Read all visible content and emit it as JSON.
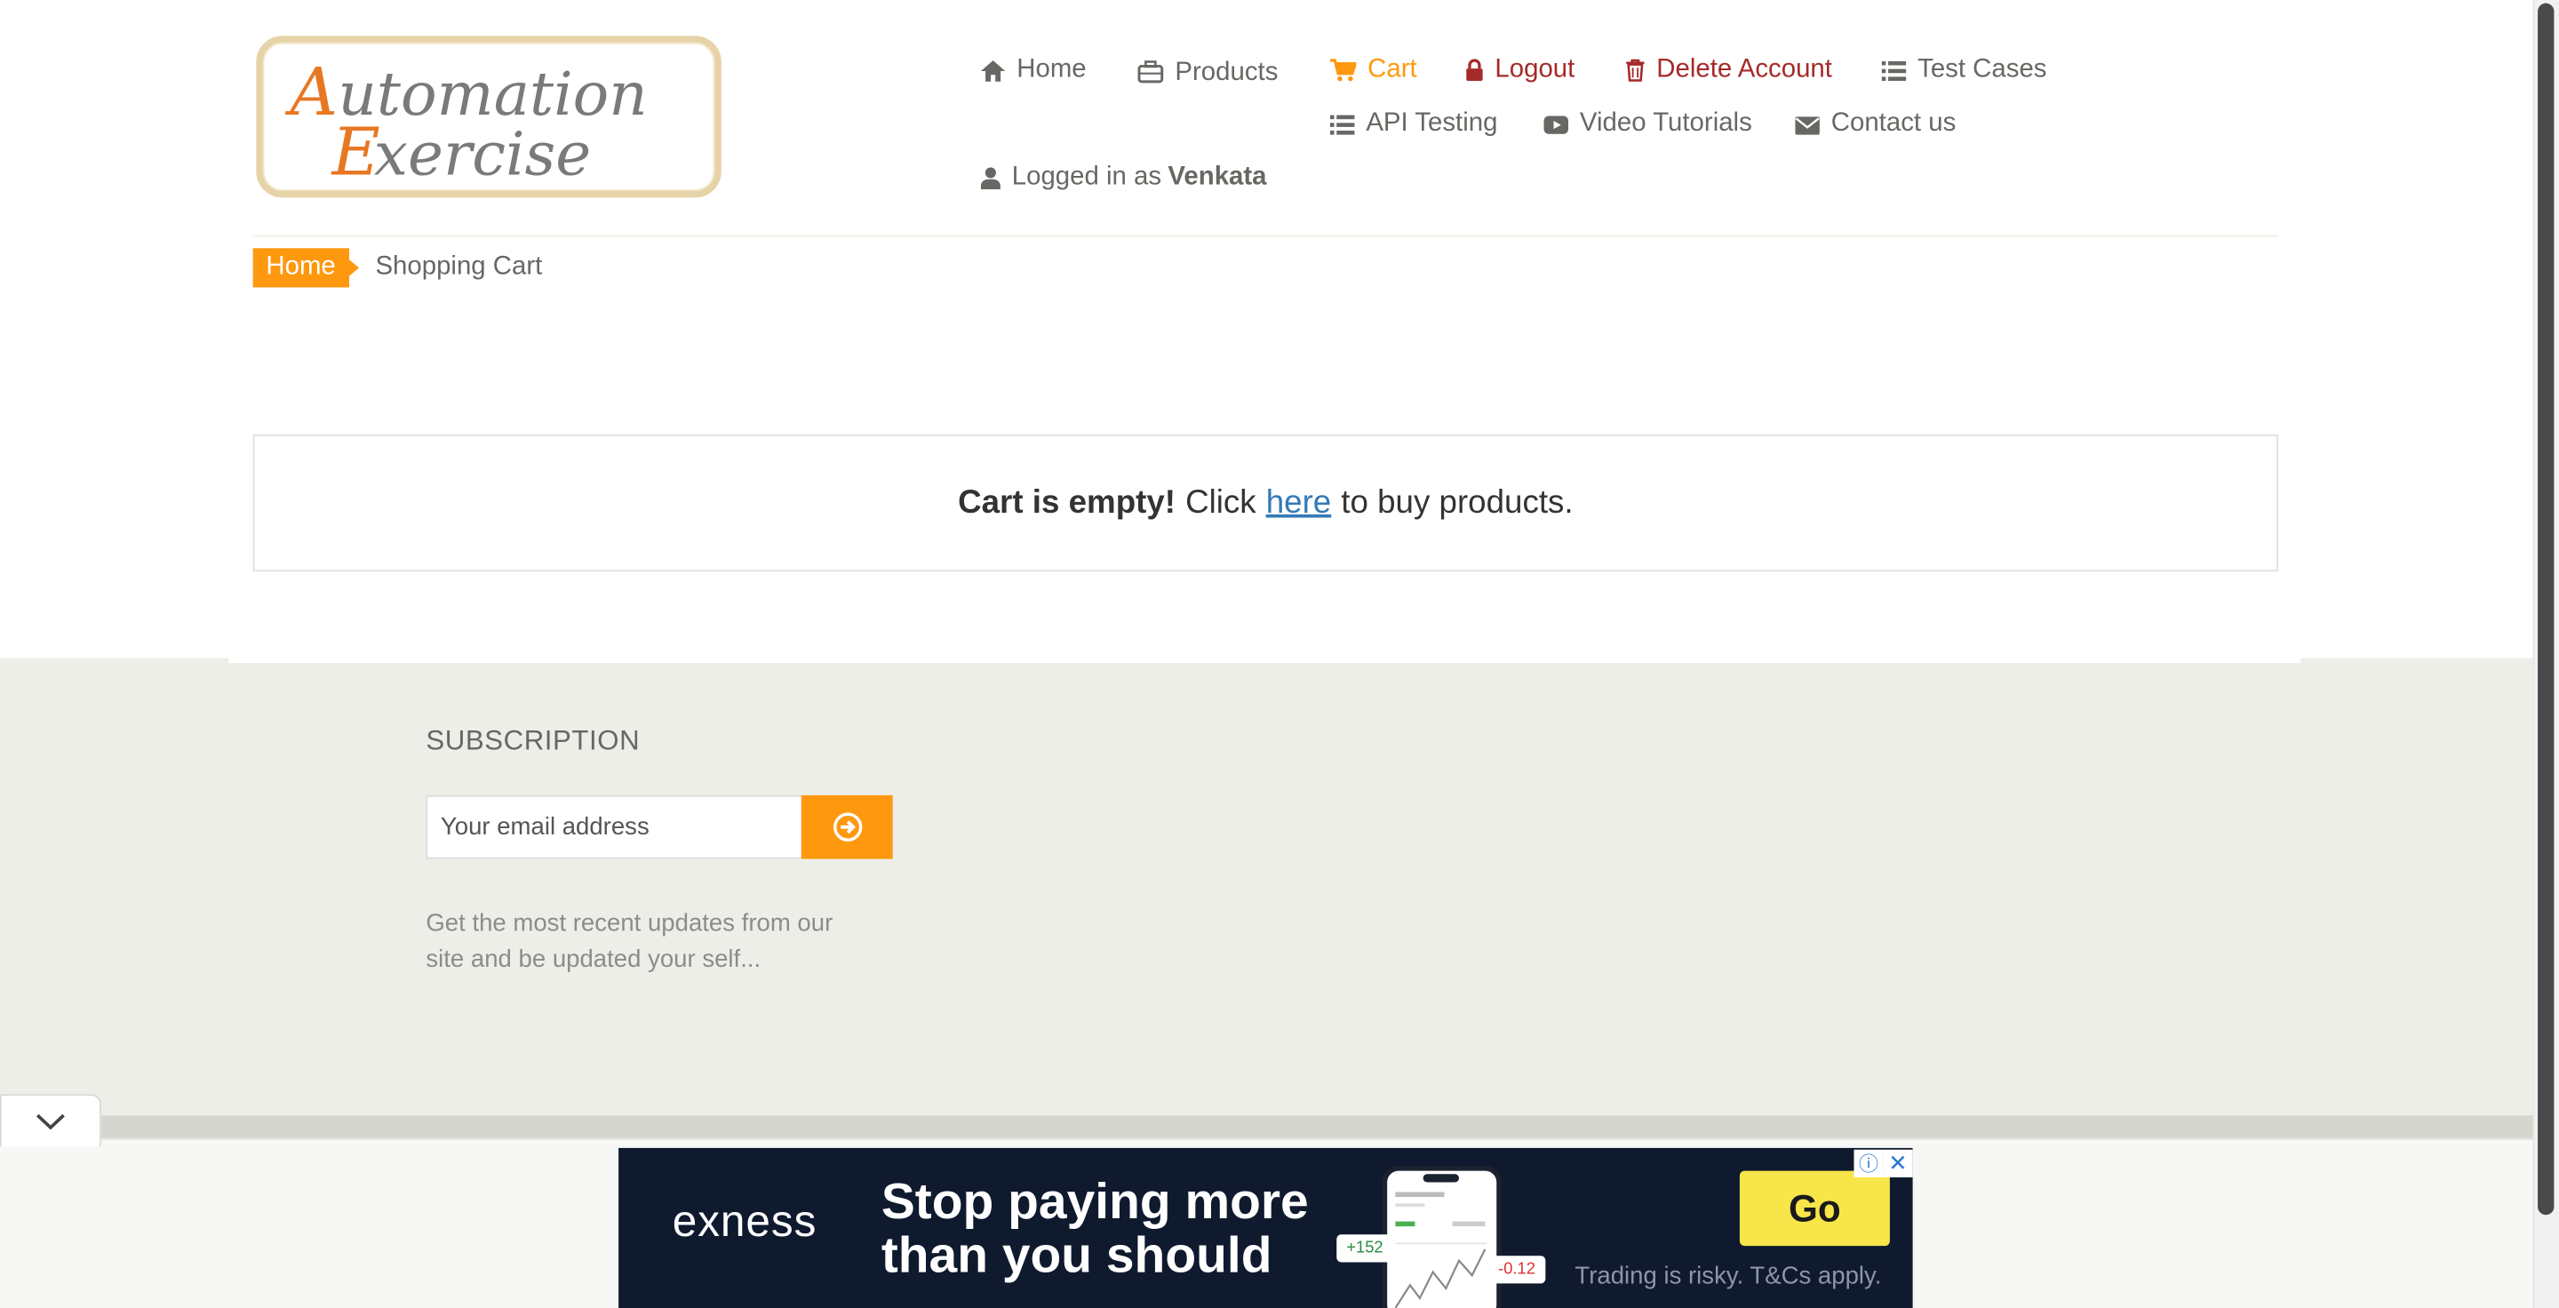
{
  "logo": {
    "line1": "Automation",
    "line2": "Exercise"
  },
  "nav": {
    "home": "Home",
    "products": "Products",
    "cart": "Cart",
    "logout": "Logout",
    "delete_account": "Delete Account",
    "test_cases": "Test Cases",
    "api_testing": "API Testing",
    "video_tutorials": "Video Tutorials",
    "contact_us": "Contact us",
    "logged_in_prefix": "Logged in as",
    "logged_in_user": "Venkata"
  },
  "breadcrumb": {
    "home": "Home",
    "current": "Shopping Cart"
  },
  "cart_empty": {
    "bold": "Cart is empty!",
    "before_link": "Click",
    "link": "here",
    "after_link": "to buy products."
  },
  "footer": {
    "subscription_title": "SUBSCRIPTION",
    "email_placeholder": "Your email address",
    "subscription_text": "Get the most recent updates from our site and be updated your self..."
  },
  "ad": {
    "brand": "exness",
    "headline": "Stop paying more than you should",
    "cta": "Go",
    "disclaimer": "Trading is risky. T&Cs apply.",
    "chip_positive": "+152",
    "chip_negative": "-0.12"
  },
  "colors": {
    "accent": "#FE980F",
    "danger": "#A52A2A",
    "link": "#337AB7",
    "footer_bg": "#EEEEE8"
  }
}
